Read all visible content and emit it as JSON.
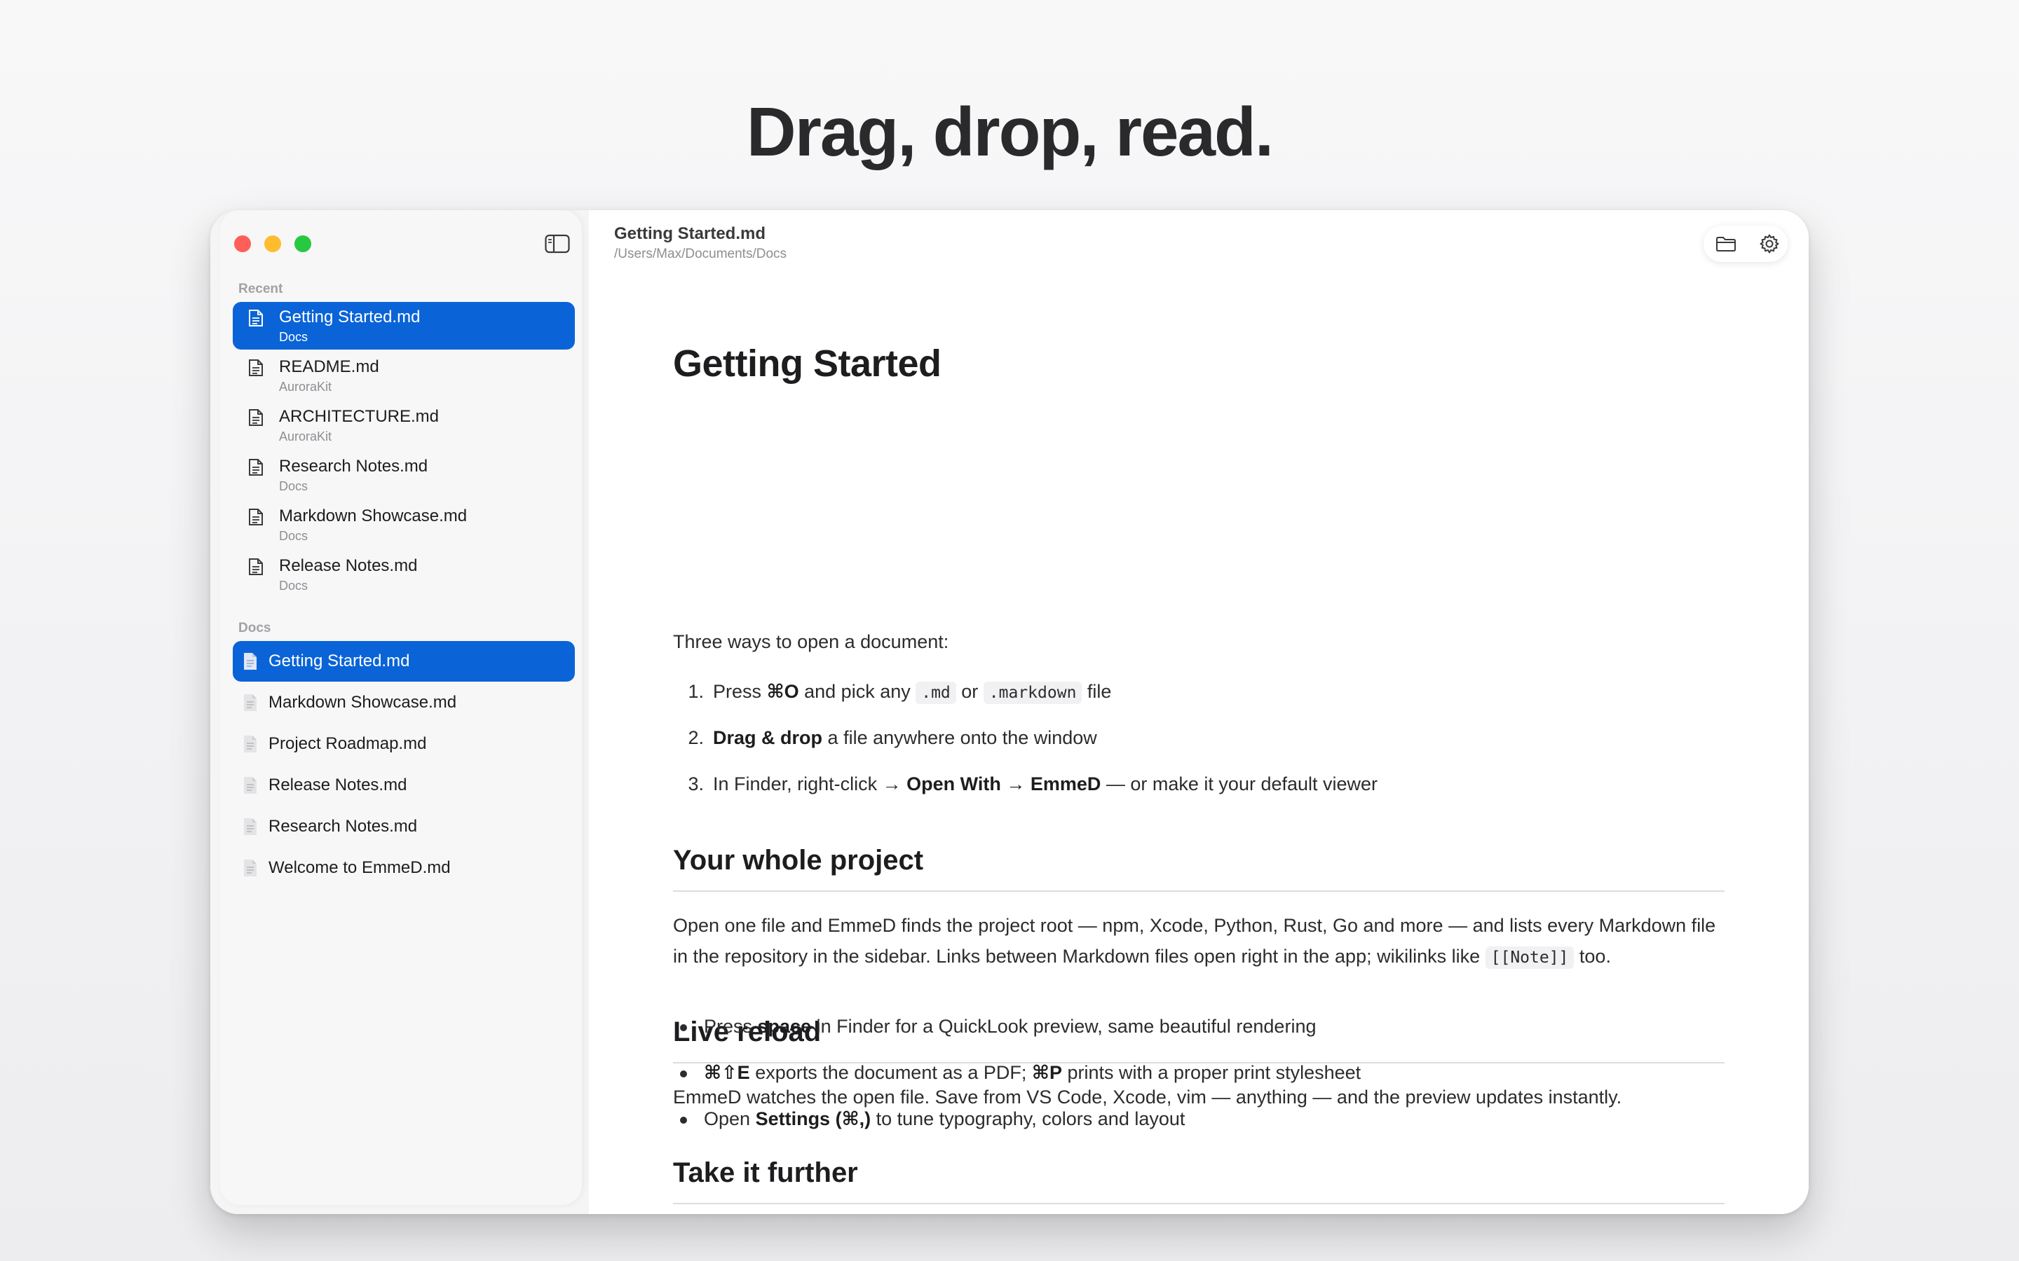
{
  "headline": "Drag, drop, read.",
  "colors": {
    "accent": "#0a64d8",
    "close": "#fe5f57",
    "minimize": "#febc2e",
    "zoom": "#28c840"
  },
  "sidebar": {
    "recent_label": "Recent",
    "recent": [
      {
        "title": "Getting Started.md",
        "sub": "Docs",
        "selected": true
      },
      {
        "title": "README.md",
        "sub": "AuroraKit"
      },
      {
        "title": "ARCHITECTURE.md",
        "sub": "AuroraKit"
      },
      {
        "title": "Research Notes.md",
        "sub": "Docs"
      },
      {
        "title": "Markdown Showcase.md",
        "sub": "Docs"
      },
      {
        "title": "Release Notes.md",
        "sub": "Docs"
      }
    ],
    "docs_label": "Docs",
    "docs": [
      {
        "title": "Getting Started.md",
        "selected": true
      },
      {
        "title": "Markdown Showcase.md"
      },
      {
        "title": "Project Roadmap.md"
      },
      {
        "title": "Release Notes.md"
      },
      {
        "title": "Research Notes.md"
      },
      {
        "title": "Welcome to EmmeD.md"
      }
    ]
  },
  "header": {
    "doc_name": "Getting Started.md",
    "doc_path": "/Users/Max/Documents/Docs",
    "icons": [
      "folder-icon",
      "gear-icon"
    ]
  },
  "doc": {
    "title": "Getting Started",
    "intro": "Three ways to open a document:",
    "steps": [
      {
        "n": "1.",
        "pre": "Press ",
        "b1": "⌘O",
        "mid": " and pick any ",
        "c1": ".md",
        "mid2": " or ",
        "c2": ".markdown",
        "post": " file"
      },
      {
        "n": "2.",
        "b1": "Drag & drop",
        "post": " a file anywhere onto the window"
      },
      {
        "n": "3.",
        "pre": "In Finder, right-click → ",
        "b1": "Open With → EmmeD",
        "post": " — or make it your default viewer"
      }
    ],
    "section2": {
      "title": "Your whole project",
      "p1": "Open one file and EmmeD finds the project root — npm, Xcode, Python, Rust, Go and more — and lists every Markdown file in the repository in the sidebar. Links between Markdown files open right in the app; wikilinks like ",
      "code": "[[Note]]",
      "p2": " too."
    },
    "section3": {
      "title": "Live reload",
      "p": "EmmeD watches the open file. Save from VS Code, Xcode, vim — anything — and the preview updates instantly."
    },
    "section4": {
      "title": "Take it further",
      "bullets": [
        {
          "pre": "Press ",
          "b": "space",
          "post": " in Finder for a QuickLook preview, same beautiful rendering"
        },
        {
          "b": "⌘⇧E",
          "mid": " exports the document as a PDF; ",
          "b2": "⌘P",
          "post": " prints with a proper print stylesheet"
        },
        {
          "pre": "Open ",
          "b": "Settings (⌘,)",
          "post": " to tune typography, colors and layout"
        }
      ]
    }
  }
}
